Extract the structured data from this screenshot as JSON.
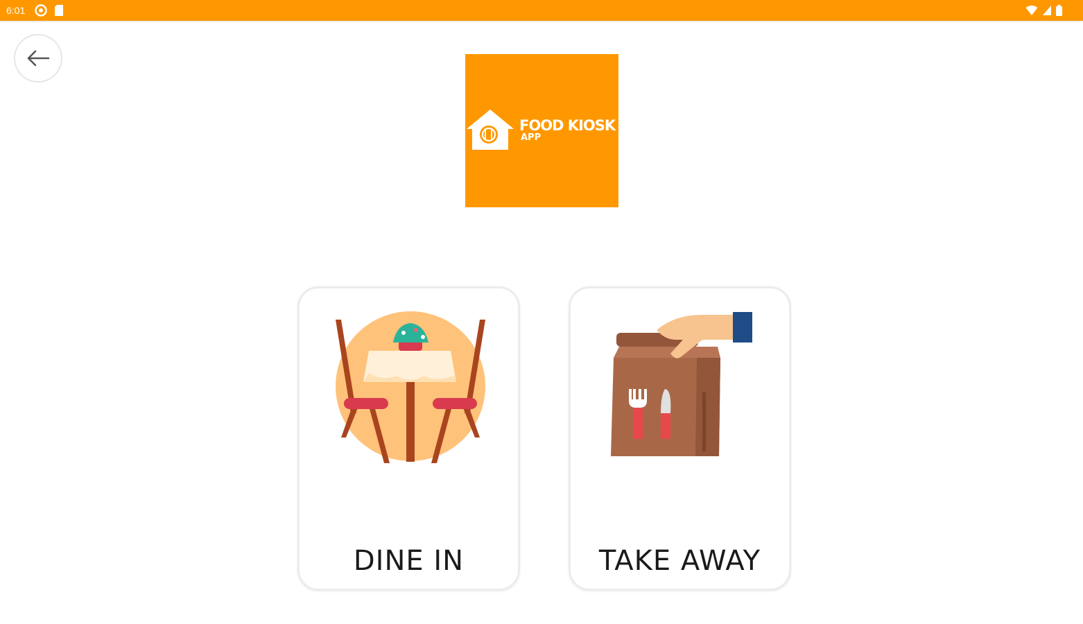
{
  "status_bar": {
    "time": "6:01",
    "color": "#ff9800",
    "left_icons": [
      "location-icon",
      "sd-card-icon"
    ],
    "right_icons": [
      "wifi-icon",
      "signal-icon",
      "battery-icon"
    ]
  },
  "header": {
    "back_icon": "arrow-left-icon"
  },
  "logo": {
    "title": "FOOD KIOSK",
    "subtitle": "APP",
    "background": "#ff9800"
  },
  "options": [
    {
      "label": "DINE IN",
      "icon": "dine-in-table-icon"
    },
    {
      "label": "TAKE AWAY",
      "icon": "take-away-bag-icon"
    }
  ]
}
